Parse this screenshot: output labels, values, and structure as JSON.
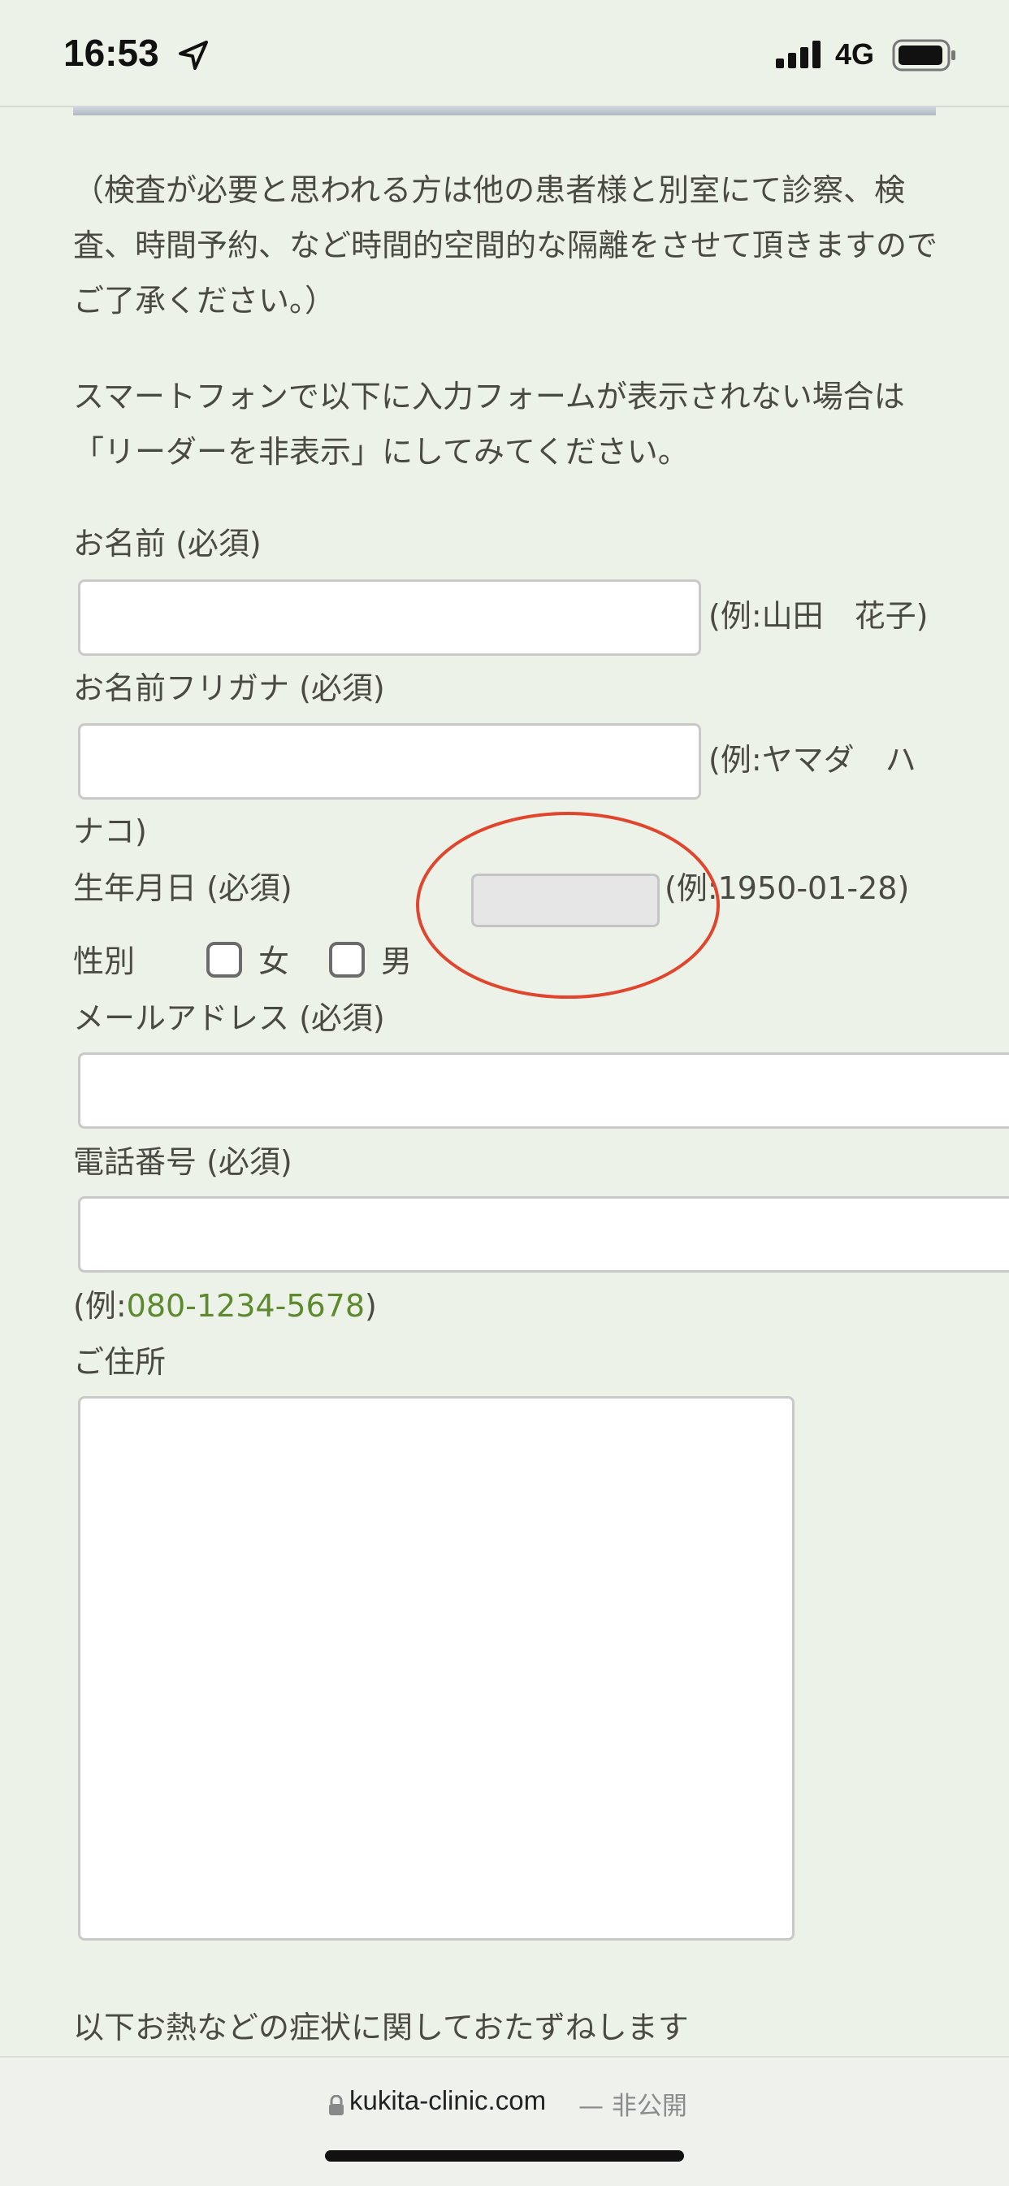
{
  "status_bar": {
    "time": "16:53",
    "network": "4G"
  },
  "content": {
    "notice_text": "（検査が必要と思われる方は他の患者様と別室にて診察、検査、時間予約、など時間的空間的な隔離をさせて頂きますのでご了承ください。）",
    "reader_notice": "スマートフォンで以下に入力フォームが表示されない場合は「リーダーを非表示」にしてみてください。",
    "name": {
      "label": "お名前 (必須)",
      "example": "(例:山田　花子)"
    },
    "furigana": {
      "label": "お名前フリガナ (必須)",
      "example_line1": "(例:ヤマダ　ハ",
      "example_line2": "ナコ)"
    },
    "birthdate": {
      "label": "生年月日 (必須)",
      "example": "(例:1950-01-28)"
    },
    "gender": {
      "label": "性別",
      "option_female": "女",
      "option_male": "男"
    },
    "email": {
      "label": "メールアドレス (必須)"
    },
    "phone": {
      "label": "電話番号 (必須)",
      "example_prefix": "(例:",
      "example_number": "080-1234-5678",
      "example_suffix": ")"
    },
    "address": {
      "label": "ご住所"
    },
    "symptoms_heading": "以下お熱などの症状に関しておたずねします"
  },
  "browser": {
    "domain": "kukita-clinic.com",
    "status": "— 非公開"
  },
  "colors": {
    "background": "#edf2e8",
    "highlight_circle": "#e0452e",
    "link_green": "#5d8a2e"
  }
}
